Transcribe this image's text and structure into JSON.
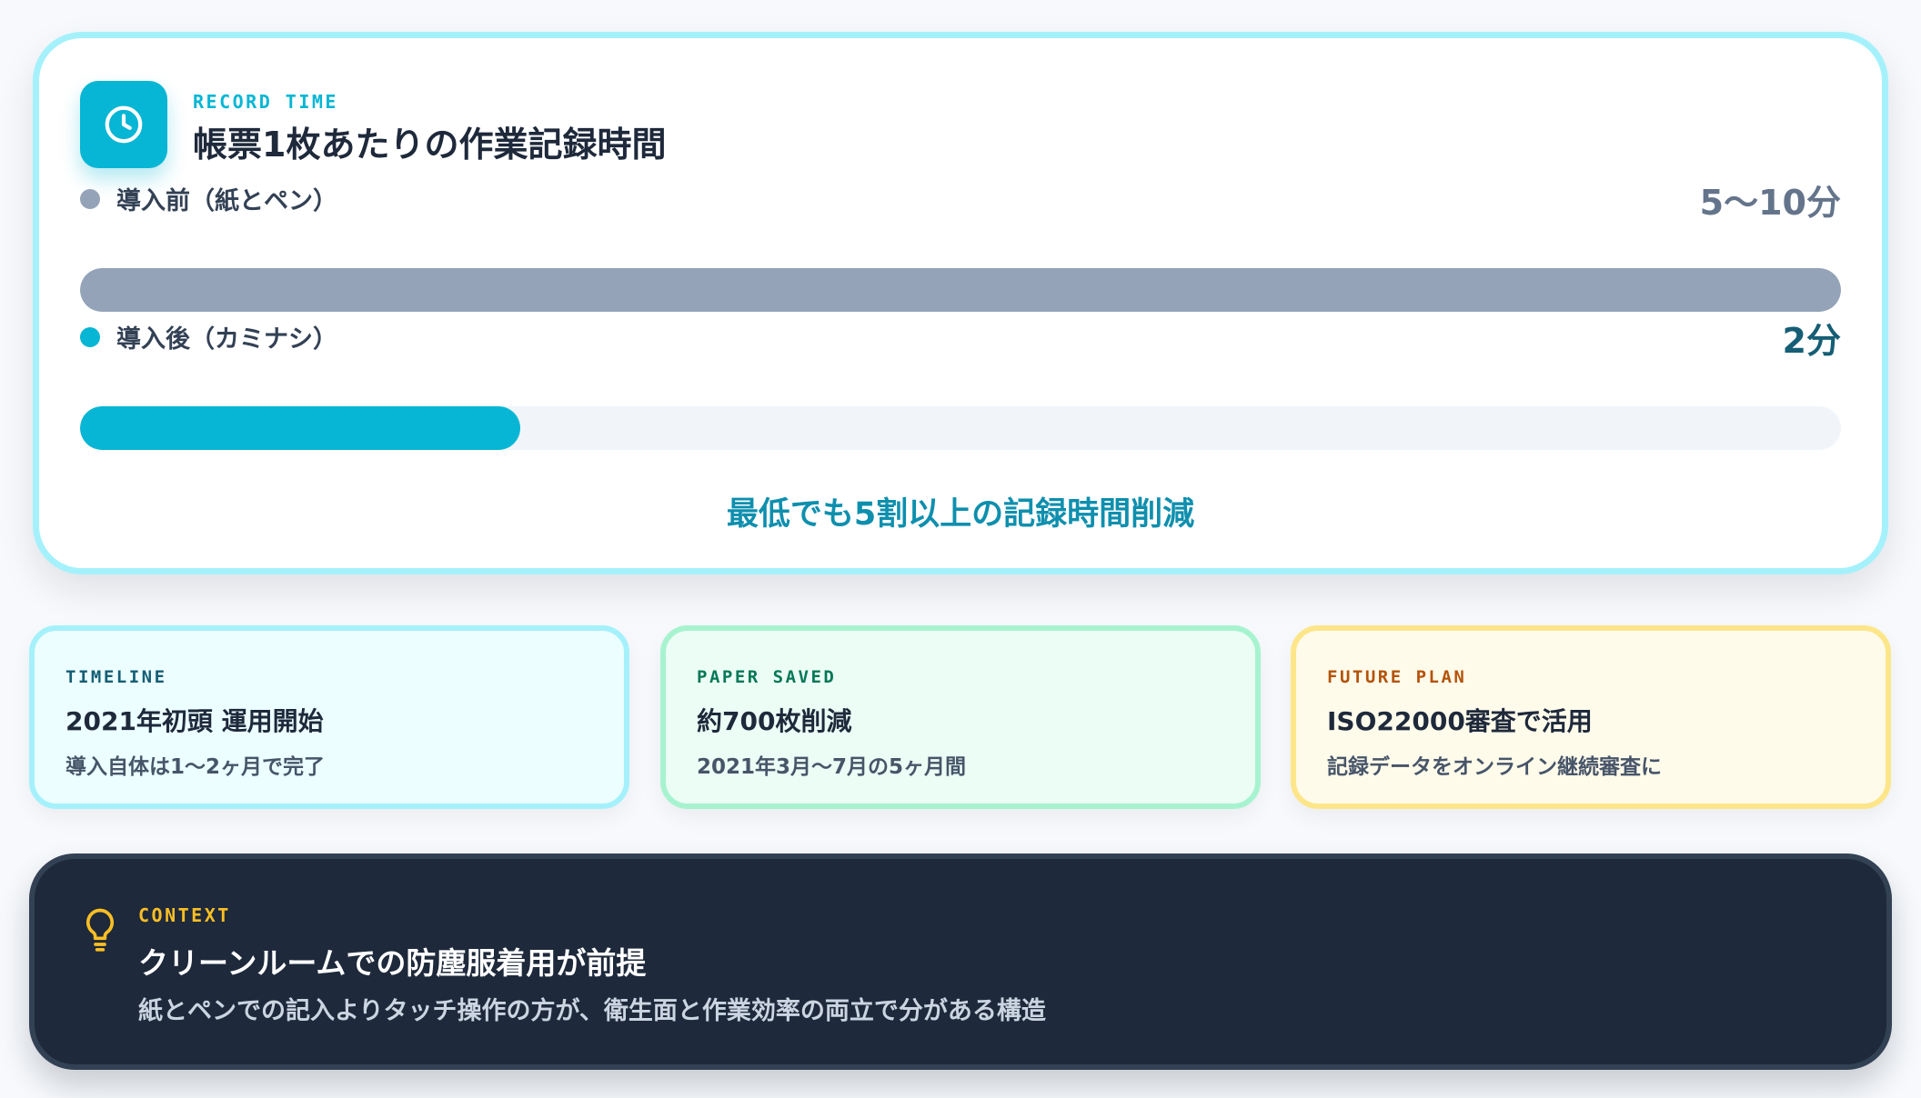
{
  "colors": {
    "accent": "#06b6d4",
    "before": "#94a3b8",
    "after": "#06b6d4",
    "summary": "#0e8fae",
    "timeline": "#155e75",
    "paper": "#047857",
    "future": "#b45309",
    "context": "#fbbf24"
  },
  "record": {
    "icon": "clock-icon",
    "eyebrow": "RECORD TIME",
    "title": "帳票1枚あたりの作業記録時間",
    "before": {
      "label": "導入前（紙とペン）",
      "value": "5〜10分",
      "fill_fraction": 1.0
    },
    "after": {
      "label": "導入後（カミナシ）",
      "value": "2分",
      "fill_fraction": 0.25
    },
    "summary": "最低でも5割以上の記録時間削減"
  },
  "cards": [
    {
      "eyebrow": "TIMELINE",
      "title": "2021年初頭 運用開始",
      "sub": "導入自体は1〜2ヶ月で完了"
    },
    {
      "eyebrow": "PAPER SAVED",
      "title": "約700枚削減",
      "sub": "2021年3月〜7月の5ヶ月間"
    },
    {
      "eyebrow": "FUTURE PLAN",
      "title": "ISO22000審査で活用",
      "sub": "記録データをオンライン継続審査に"
    }
  ],
  "context": {
    "icon": "lightbulb-icon",
    "eyebrow": "CONTEXT",
    "title": "クリーンルームでの防塵服着用が前提",
    "body": "紙とペンでの記入よりタッチ操作の方が、衛生面と作業効率の両立で分がある構造"
  }
}
